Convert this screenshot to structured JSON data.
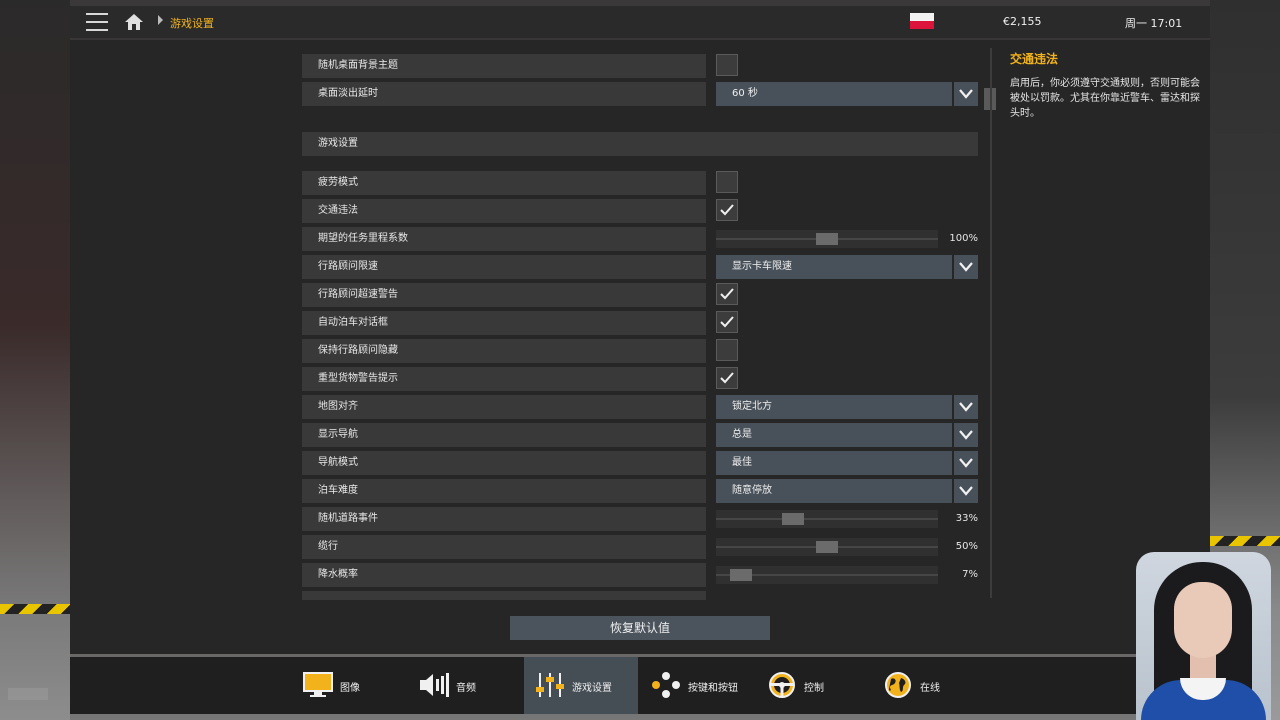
{
  "topbar": {
    "breadcrumb": "游戏设置",
    "money": "€2,155",
    "time": "周一 17:01"
  },
  "rows_top": [
    {
      "label": "随机桌面背景主题",
      "control": "checkbox",
      "checked": false
    },
    {
      "label": "桌面淡出延时",
      "control": "dropdown",
      "value": "60 秒"
    }
  ],
  "section_title": "游戏设置",
  "rows": [
    {
      "label": "疲劳模式",
      "control": "checkbox",
      "checked": false
    },
    {
      "label": "交通违法",
      "control": "checkbox",
      "checked": true
    },
    {
      "label": "期望的任务里程系数",
      "control": "slider",
      "level": 0.5,
      "value": "100%"
    },
    {
      "label": "行路顾问限速",
      "control": "dropdown",
      "value": "显示卡车限速"
    },
    {
      "label": "行路顾问超速警告",
      "control": "checkbox",
      "checked": true
    },
    {
      "label": "自动泊车对话框",
      "control": "checkbox",
      "checked": true
    },
    {
      "label": "保持行路顾问隐藏",
      "control": "checkbox",
      "checked": false
    },
    {
      "label": "重型货物警告提示",
      "control": "checkbox",
      "checked": true
    },
    {
      "label": "地图对齐",
      "control": "dropdown",
      "value": "锁定北方"
    },
    {
      "label": "显示导航",
      "control": "dropdown",
      "value": "总是"
    },
    {
      "label": "导航模式",
      "control": "dropdown",
      "value": "最佳"
    },
    {
      "label": "泊车难度",
      "control": "dropdown",
      "value": "随意停放"
    },
    {
      "label": "随机道路事件",
      "control": "slider",
      "level": 0.33,
      "value": "33%"
    },
    {
      "label": "缆行",
      "control": "slider",
      "level": 0.5,
      "value": "50%"
    },
    {
      "label": "降水概率",
      "control": "slider",
      "level": 0.07,
      "value": "7%"
    }
  ],
  "help": {
    "title": "交通违法",
    "text": "启用后，你必须遵守交通规则，否则可能会被处以罚款。尤其在你靠近警车、雷达和探头时。"
  },
  "reset_label": "恢复默认值",
  "tabs": [
    {
      "label": "图像",
      "icon": "monitor-icon",
      "active": false
    },
    {
      "label": "音频",
      "icon": "speaker-icon",
      "active": false
    },
    {
      "label": "游戏设置",
      "icon": "sliders-icon",
      "active": true
    },
    {
      "label": "按键和按钮",
      "icon": "gamepad-buttons-icon",
      "active": false
    },
    {
      "label": "控制",
      "icon": "steering-wheel-icon",
      "active": false
    },
    {
      "label": "在线",
      "icon": "globe-icon",
      "active": false
    }
  ],
  "colors": {
    "accent": "#f2b21c",
    "panel": "#262626",
    "row": "#393939",
    "dropdown": "#48515a",
    "active_tab": "#454d55"
  }
}
